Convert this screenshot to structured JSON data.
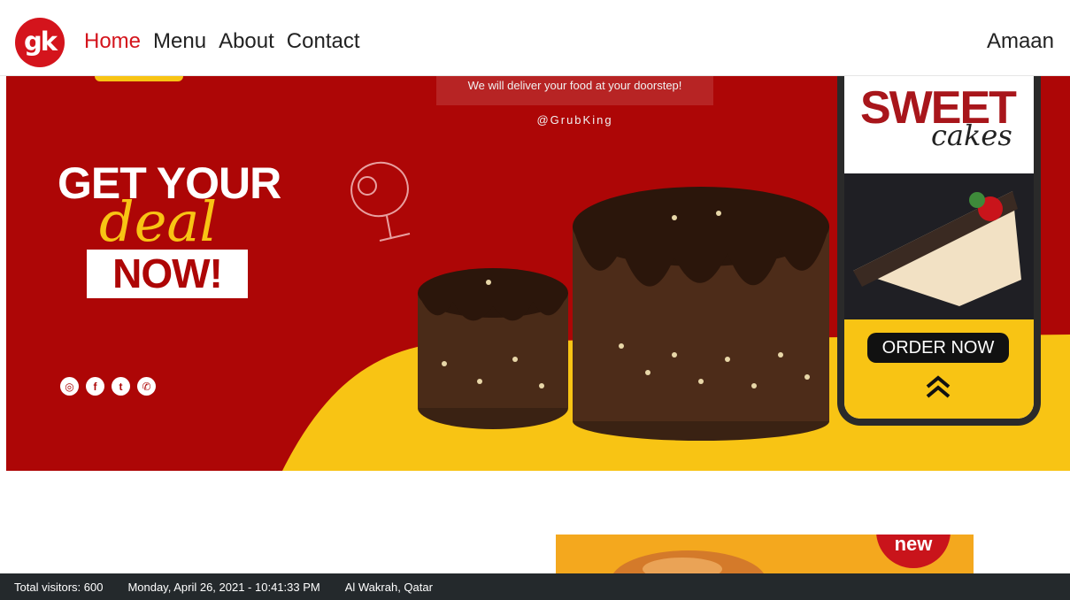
{
  "header": {
    "logo_text": "gk",
    "nav": [
      "Home",
      "Menu",
      "About",
      "Contact"
    ],
    "user": "Amaan"
  },
  "hero": {
    "tagline": "We will deliver your food at your doorstep!",
    "handle": "@GrubKing",
    "headline_top": "GET YOUR",
    "headline_script": "deal",
    "headline_bottom": "NOW!",
    "socials": [
      "instagram-icon",
      "facebook-icon",
      "twitter-icon",
      "whatsapp-icon"
    ],
    "phone": {
      "title": "SWEET",
      "subtitle": "cakes",
      "cta": "ORDER NOW"
    }
  },
  "promo": {
    "badge": "new"
  },
  "status_bar": {
    "visitors": "Total visitors: 600",
    "datetime": "Monday, April 26, 2021 - 10:41:33 PM",
    "location": "Al Wakrah, Qatar"
  },
  "colors": {
    "brand_red": "#d4141c",
    "hero_red": "#ad0606",
    "yellow": "#f8c414",
    "status_bg": "#24292c"
  }
}
